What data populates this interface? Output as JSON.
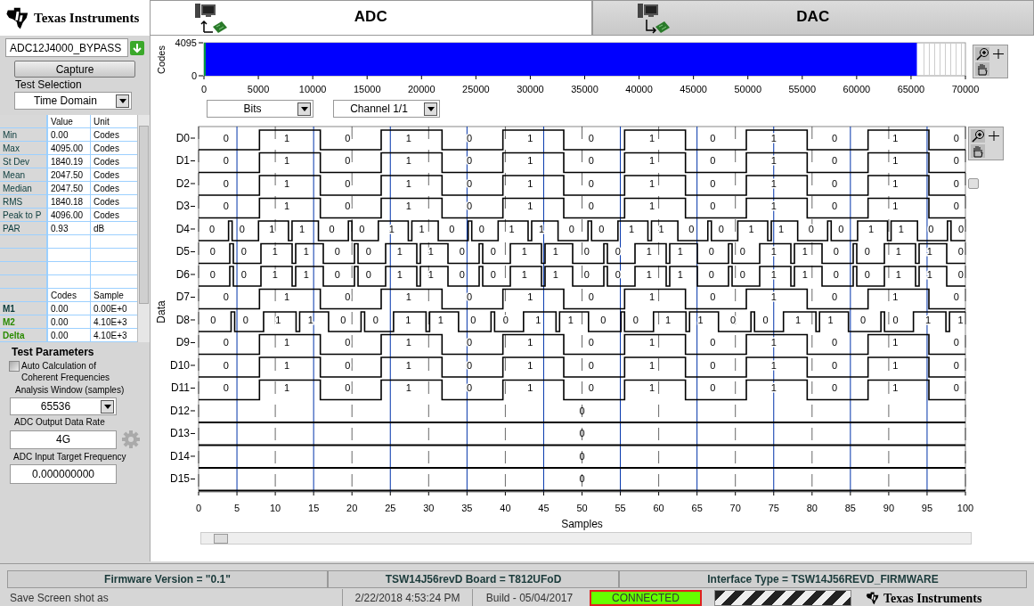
{
  "device": {
    "value": "ADC12J4000_BYPASS"
  },
  "capture_button": "Capture",
  "test_selection": {
    "label": "Test Selection",
    "value": "Time Domain"
  },
  "stats": {
    "columns": [
      "Value",
      "Unit"
    ],
    "rows": [
      {
        "label": "Min",
        "value": "0.00",
        "unit": "Codes"
      },
      {
        "label": "Max",
        "value": "4095.00",
        "unit": "Codes"
      },
      {
        "label": "St Dev",
        "value": "1840.19",
        "unit": "Codes"
      },
      {
        "label": "Mean",
        "value": "2047.50",
        "unit": "Codes"
      },
      {
        "label": "Median",
        "value": "2047.50",
        "unit": "Codes"
      },
      {
        "label": "RMS",
        "value": "1840.18",
        "unit": "Codes"
      },
      {
        "label": "Peak to P",
        "value": "4096.00",
        "unit": "Codes"
      },
      {
        "label": "PAR",
        "value": "0.93",
        "unit": "dB"
      }
    ],
    "marker_columns": [
      "Codes",
      "Sample"
    ],
    "markers": [
      {
        "label": "M1",
        "codes": "0.00",
        "sample": "0.00E+0",
        "color": "#0b3b3b"
      },
      {
        "label": "M2",
        "codes": "0.00",
        "sample": "4.10E+3",
        "color": "#2a8a00"
      },
      {
        "label": "Delta",
        "codes": "0.00",
        "sample": "4.10E+3",
        "color": "#2a8a00"
      }
    ]
  },
  "test_parameters": {
    "title": "Test Parameters",
    "auto_calc": {
      "label": "Auto Calculation of Coherent Frequencies",
      "checked": false
    },
    "analysis_window": {
      "label": "Analysis Window (samples)",
      "value": "65536"
    },
    "output_rate": {
      "label": "ADC Output Data Rate",
      "value": "4G"
    },
    "target_freq": {
      "label": "ADC Input Target Frequency",
      "value": "0.000000000"
    }
  },
  "tabs": [
    {
      "label": "ADC",
      "selected": true
    },
    {
      "label": "DAC",
      "selected": false
    }
  ],
  "overview": {
    "ylabel": "Codes",
    "yticks": [
      "4095",
      "0"
    ],
    "xticks": [
      "0",
      "5000",
      "10000",
      "15000",
      "20000",
      "25000",
      "30000",
      "35000",
      "40000",
      "45000",
      "50000",
      "55000",
      "60000",
      "65000",
      "70000"
    ]
  },
  "view_select": {
    "value": "Bits"
  },
  "channel_select": {
    "value": "Channel 1/1"
  },
  "digital": {
    "ylabel": "Data",
    "xlabel": "Samples",
    "xticks": [
      "0",
      "5",
      "10",
      "15",
      "20",
      "25",
      "30",
      "35",
      "40",
      "45",
      "50",
      "55",
      "60",
      "65",
      "70",
      "75",
      "80",
      "85",
      "90",
      "95",
      "100"
    ],
    "rows": [
      {
        "name": "D0",
        "bits": [
          "0",
          "1",
          "0",
          "1",
          "0",
          "1",
          "0",
          "1",
          "0",
          "1",
          "0",
          "1",
          "0"
        ]
      },
      {
        "name": "D1",
        "bits": [
          "0",
          "1",
          "0",
          "1",
          "0",
          "1",
          "0",
          "1",
          "0",
          "1",
          "0",
          "1",
          "0"
        ]
      },
      {
        "name": "D2",
        "bits": [
          "0",
          "1",
          "0",
          "1",
          "0",
          "1",
          "0",
          "1",
          "0",
          "1",
          "0",
          "1",
          "0"
        ]
      },
      {
        "name": "D3",
        "bits": [
          "0",
          "1",
          "0",
          "1",
          "0",
          "1",
          "0",
          "1",
          "0",
          "1",
          "0",
          "1",
          "0"
        ]
      },
      {
        "name": "D4",
        "bits": [
          "0",
          "0",
          "1",
          "1",
          "0",
          "0",
          "1",
          "1",
          "0",
          "0",
          "1",
          "1",
          "0",
          "0",
          "1",
          "1",
          "0",
          "0",
          "1",
          "1",
          "0",
          "0",
          "1",
          "1",
          "0",
          "0"
        ]
      },
      {
        "name": "D5",
        "bits": [
          "0",
          "0",
          "1",
          "1",
          "0",
          "0",
          "1",
          "1",
          "0",
          "0",
          "1",
          "1",
          "0",
          "0",
          "1",
          "1",
          "0",
          "0",
          "1",
          "1",
          "0",
          "0",
          "1",
          "1",
          "0"
        ]
      },
      {
        "name": "D6",
        "bits": [
          "0",
          "0",
          "1",
          "1",
          "0",
          "0",
          "1",
          "1",
          "0",
          "0",
          "1",
          "1",
          "0",
          "0",
          "1",
          "1",
          "0",
          "0",
          "1",
          "1",
          "0",
          "0",
          "1",
          "1",
          "0"
        ]
      },
      {
        "name": "D7",
        "bits": [
          "0",
          "1",
          "0",
          "1",
          "0",
          "1",
          "0",
          "1",
          "0",
          "1",
          "0",
          "1",
          "0"
        ]
      },
      {
        "name": "D8",
        "bits": [
          "0",
          "0",
          "1",
          "1",
          "0",
          "0",
          "1",
          "1",
          "0",
          "0",
          "1",
          "1",
          "0",
          "0",
          "1",
          "1",
          "0",
          "0",
          "1",
          "1",
          "0",
          "0",
          "1",
          "1"
        ]
      },
      {
        "name": "D9",
        "bits": [
          "0",
          "1",
          "0",
          "1",
          "0",
          "1",
          "0",
          "1",
          "0",
          "1",
          "0",
          "1",
          "0"
        ]
      },
      {
        "name": "D10",
        "bits": [
          "0",
          "1",
          "0",
          "1",
          "0",
          "1",
          "0",
          "1",
          "0",
          "1",
          "0",
          "1",
          "0"
        ]
      },
      {
        "name": "D11",
        "bits": [
          "0",
          "1",
          "0",
          "1",
          "0",
          "1",
          "0",
          "1",
          "0",
          "1",
          "0",
          "1",
          "0"
        ]
      },
      {
        "name": "D12",
        "bits": [
          "0"
        ]
      },
      {
        "name": "D13",
        "bits": [
          "0"
        ]
      },
      {
        "name": "D14",
        "bits": [
          "0"
        ]
      },
      {
        "name": "D15",
        "bits": [
          "0"
        ]
      }
    ]
  },
  "info_bar": [
    "Firmware Version = \"0.1\"",
    "TSW14J56revD Board = T812UFoD",
    "Interface Type = TSW14J56REVD_FIRMWARE"
  ],
  "status_bar": {
    "message": "Save Screen shot as",
    "datetime": "2/22/2018 4:53:24 PM",
    "build": "Build  - 05/04/2017",
    "connection": {
      "label": "CONNECTED",
      "connected": true
    }
  },
  "brand": "Texas Instruments",
  "footer_brand": "Texas Instruments"
}
